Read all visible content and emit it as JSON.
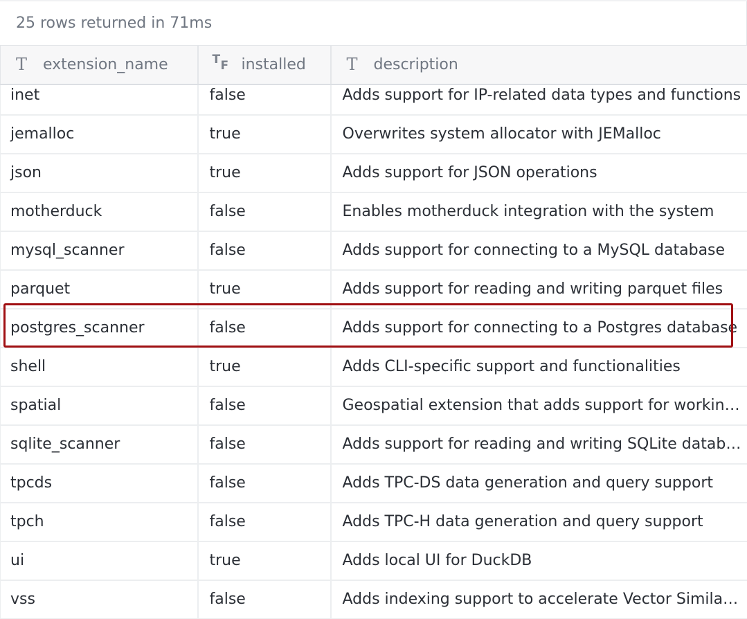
{
  "status_text": "25 rows returned in 71ms",
  "columns": [
    {
      "name": "extension_name",
      "type_icon": "text-type-icon",
      "glyph": "T"
    },
    {
      "name": "installed",
      "type_icon": "boolean-type-icon",
      "glyph_t": "T",
      "glyph_f": "F"
    },
    {
      "name": "description",
      "type_icon": "text-type-icon",
      "glyph": "T"
    }
  ],
  "rows": [
    {
      "extension_name": "inet",
      "installed": "false",
      "description": "Adds support for IP-related data types and functions"
    },
    {
      "extension_name": "jemalloc",
      "installed": "true",
      "description": "Overwrites system allocator with JEMalloc"
    },
    {
      "extension_name": "json",
      "installed": "true",
      "description": "Adds support for JSON operations"
    },
    {
      "extension_name": "motherduck",
      "installed": "false",
      "description": "Enables motherduck integration with the system"
    },
    {
      "extension_name": "mysql_scanner",
      "installed": "false",
      "description": "Adds support for connecting to a MySQL database"
    },
    {
      "extension_name": "parquet",
      "installed": "true",
      "description": "Adds support for reading and writing parquet files"
    },
    {
      "extension_name": "postgres_scanner",
      "installed": "false",
      "description": "Adds support for connecting to a Postgres database"
    },
    {
      "extension_name": "shell",
      "installed": "true",
      "description": "Adds CLI-specific support and functionalities"
    },
    {
      "extension_name": "spatial",
      "installed": "false",
      "description": "Geospatial extension that adds support for working with spatial data"
    },
    {
      "extension_name": "sqlite_scanner",
      "installed": "false",
      "description": "Adds support for reading and writing SQLite database files"
    },
    {
      "extension_name": "tpcds",
      "installed": "false",
      "description": "Adds TPC-DS data generation and query support"
    },
    {
      "extension_name": "tpch",
      "installed": "false",
      "description": "Adds TPC-H data generation and query support"
    },
    {
      "extension_name": "ui",
      "installed": "true",
      "description": "Adds local UI for DuckDB"
    },
    {
      "extension_name": "vss",
      "installed": "false",
      "description": "Adds indexing support to accelerate Vector Similarity Search"
    }
  ],
  "highlighted_row": "postgres_scanner",
  "colors": {
    "highlight_border": "#a00f12",
    "header_bg": "#f7f7f8",
    "status_text": "#6f7681"
  }
}
